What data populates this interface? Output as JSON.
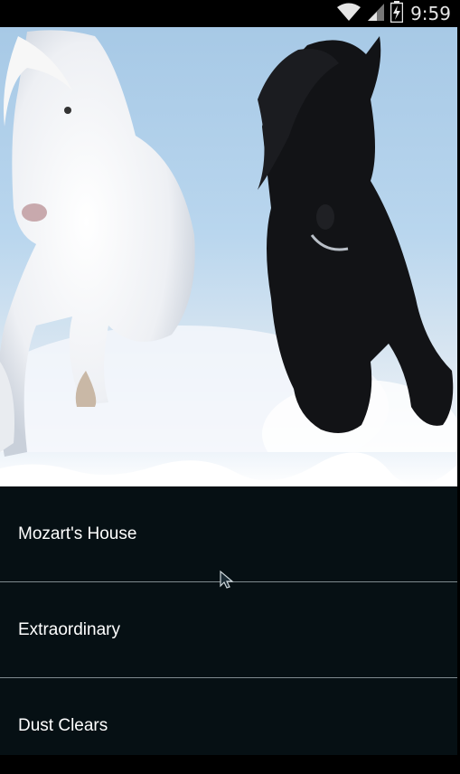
{
  "status_bar": {
    "time": "9:59",
    "icons": [
      "wifi-icon",
      "cell-signal-icon",
      "battery-charging-icon"
    ]
  },
  "hero": {
    "image": "horses-running-in-snow"
  },
  "list": {
    "items": [
      {
        "label": "Mozart's House"
      },
      {
        "label": "Extraordinary"
      },
      {
        "label": "Dust Clears"
      }
    ]
  },
  "colors": {
    "status_bar_bg": "#000000",
    "list_bg": "#061014",
    "divider": "#7f8a8f",
    "text": "#ffffff"
  }
}
